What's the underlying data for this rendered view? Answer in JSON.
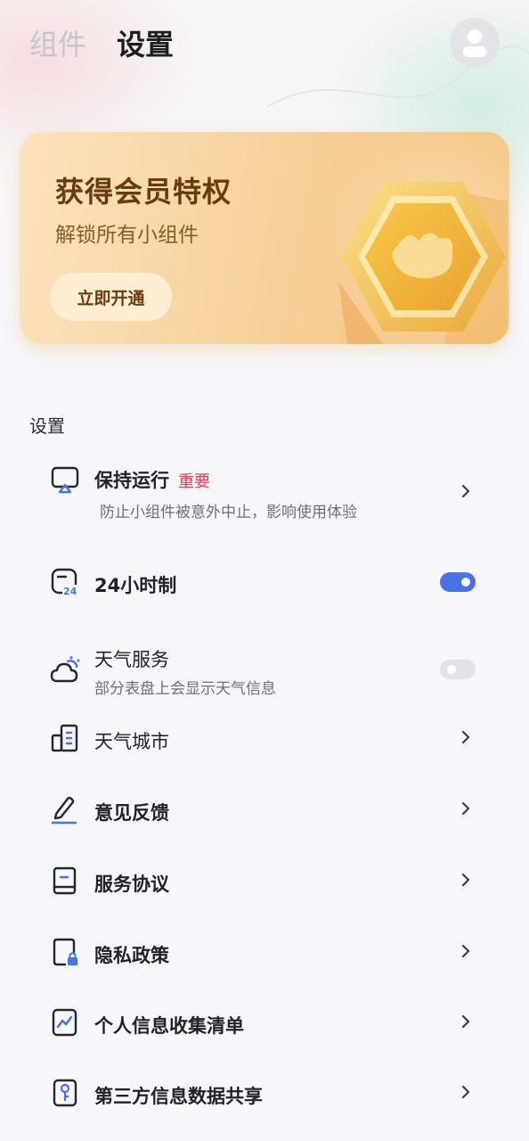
{
  "header": {
    "tabs": [
      {
        "label": "组件",
        "active": false
      },
      {
        "label": "设置",
        "active": true
      }
    ],
    "avatar_icon": "user-icon"
  },
  "promo": {
    "title": "获得会员特权",
    "subtitle": "解锁所有小组件",
    "button_label": "立即开通",
    "art_icon": "crown-hexagon-badge"
  },
  "settings": {
    "section_title": "设置",
    "items": [
      {
        "icon": "screen-keep-running-icon",
        "label": "保持运行",
        "tag": "重要",
        "subtitle": "防止小组件被意外中止，影响使用体验",
        "control": "chevron"
      },
      {
        "icon": "clock-24-icon",
        "label": "24小时制",
        "control": "toggle",
        "enabled": true
      },
      {
        "icon": "weather-cloud-sun-icon",
        "label": "天气服务",
        "subtitle": "部分表盘上会显示天气信息",
        "control": "toggle",
        "enabled": false
      },
      {
        "icon": "city-building-icon",
        "label": "天气城市",
        "control": "chevron"
      },
      {
        "icon": "pencil-feedback-icon",
        "label": "意见反馈",
        "control": "chevron"
      },
      {
        "icon": "book-agreement-icon",
        "label": "服务协议",
        "control": "chevron"
      },
      {
        "icon": "document-lock-icon",
        "label": "隐私政策",
        "control": "chevron"
      },
      {
        "icon": "chart-list-icon",
        "label": "个人信息收集清单",
        "control": "chevron"
      },
      {
        "icon": "key-share-icon",
        "label": "第三方信息数据共享",
        "control": "chevron"
      }
    ]
  },
  "colors": {
    "accent": "#4a72e8",
    "important_tag": "#e0454f",
    "promo_title": "#6a3a0f",
    "background": "#f6f7fb"
  }
}
